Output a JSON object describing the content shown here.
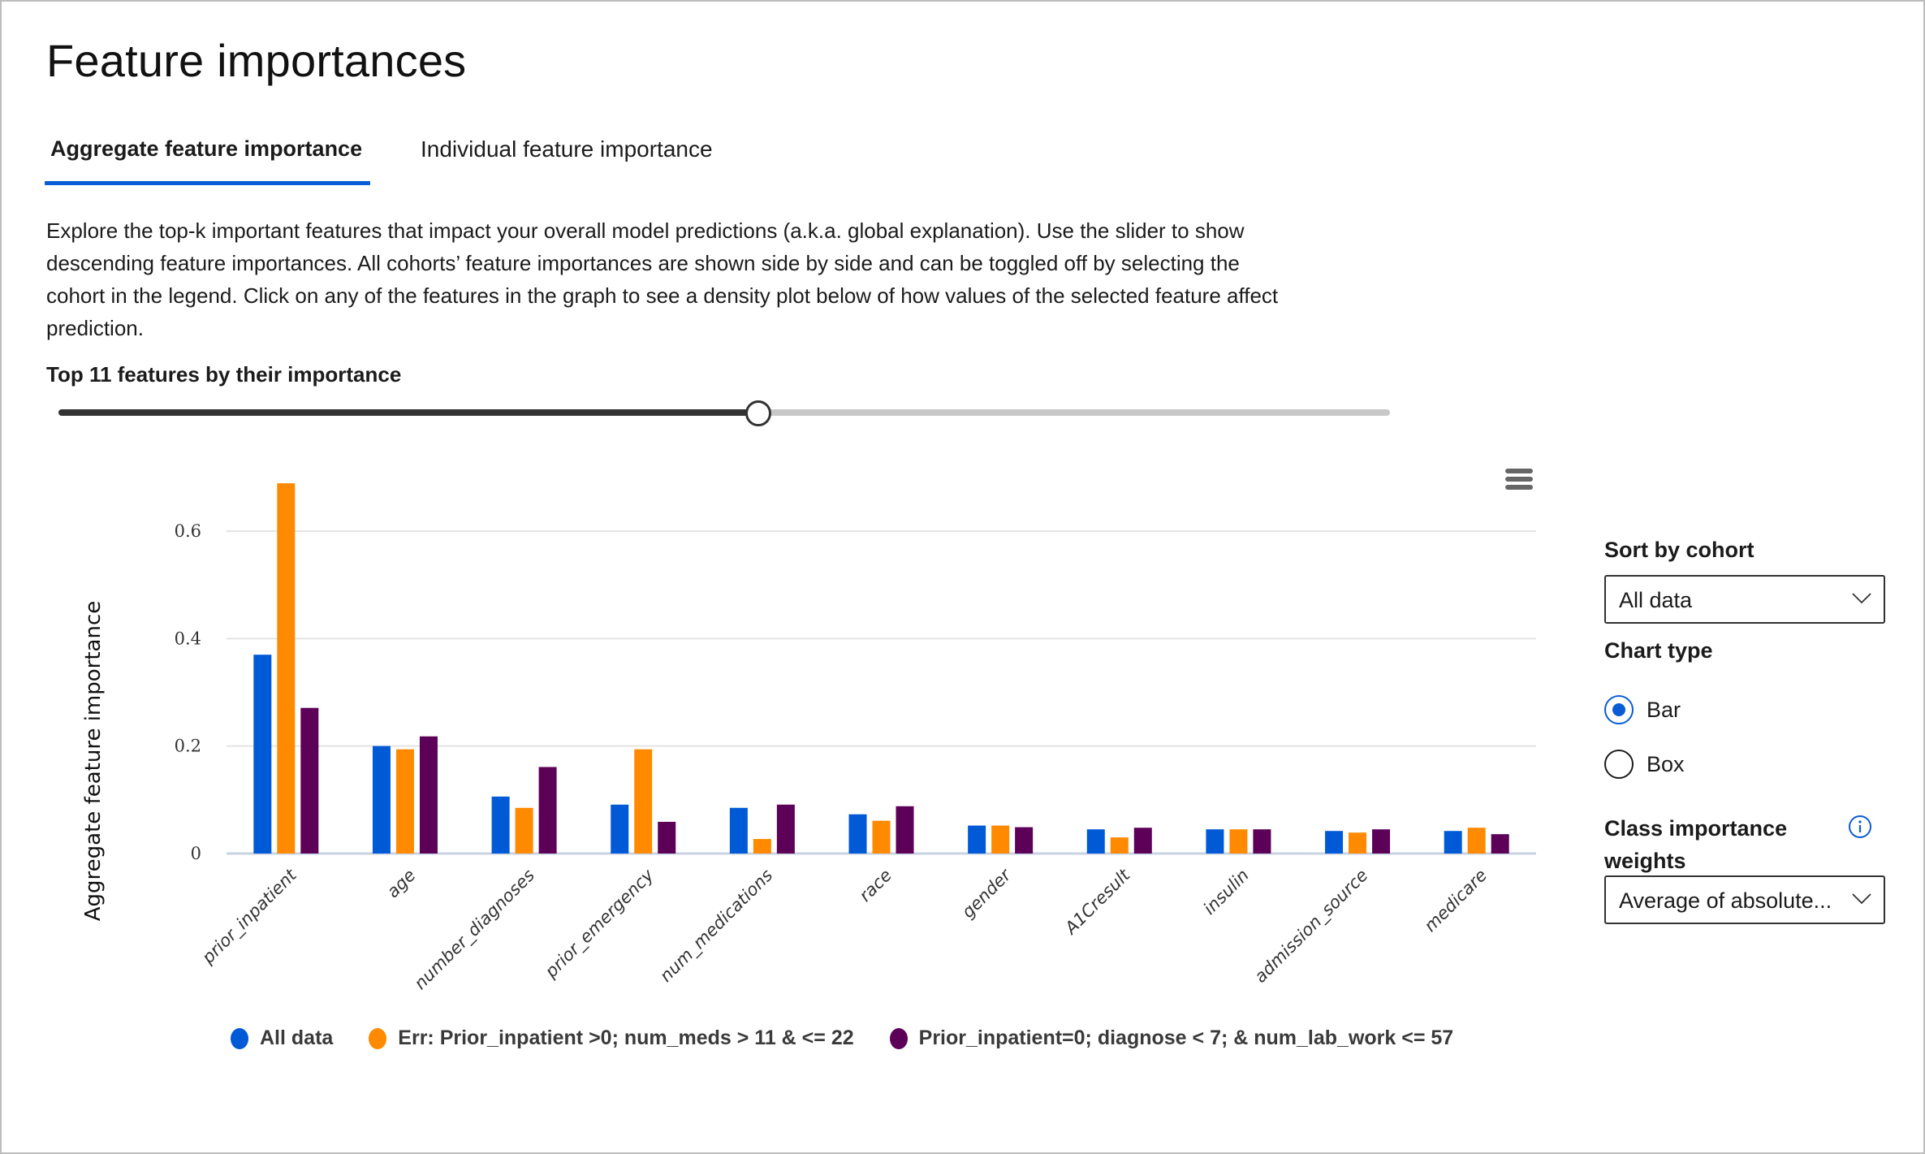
{
  "page": {
    "title": "Feature importances",
    "tabs": [
      {
        "label": "Aggregate feature importance",
        "selected": true
      },
      {
        "label": "Individual feature importance",
        "selected": false
      }
    ],
    "description": "Explore the top-k important features that impact your overall model predictions (a.k.a. global explanation). Use the slider to show descending feature importances. All cohorts’ feature importances are shown side by side and can be toggled off by selecting the cohort in the legend. Click on any of the features in the graph to see a density plot below of how values of the selected feature affect prediction."
  },
  "slider": {
    "label": "Top 11 features by their importance",
    "value": 11,
    "fraction": 0.525
  },
  "side_panel": {
    "sort_label": "Sort by cohort",
    "sort_value": "All data",
    "chart_type_label": "Chart type",
    "chart_types": [
      {
        "label": "Bar",
        "checked": true
      },
      {
        "label": "Box",
        "checked": false
      }
    ],
    "class_weights_label": "Class importance weights",
    "class_weights_value": "Average of absolute...",
    "info_icon": "info-icon"
  },
  "icons": {
    "menu": "hamburger-menu-icon",
    "dropdown": "chevron-down-icon",
    "info": "info-icon"
  },
  "colors": {
    "accent": "#0a5cd6",
    "all_data": "#005ad6",
    "err_cohort": "#ff8a00",
    "prior_cohort": "#5c0058"
  },
  "chart_data": {
    "type": "bar",
    "title": "",
    "xlabel": "",
    "ylabel": "Aggregate feature importance",
    "ylim": [
      0,
      0.72
    ],
    "yticks": [
      0,
      0.2,
      0.4,
      0.6
    ],
    "ytick_labels": [
      "0",
      "0.2",
      "0.4",
      "0.6"
    ],
    "grid": true,
    "legend_position": "bottom",
    "categories": [
      "prior_inpatient",
      "age",
      "number_diagnoses",
      "prior_emergency",
      "num_medications",
      "race",
      "gender",
      "A1Cresult",
      "insulin",
      "admission_source",
      "medicare"
    ],
    "series": [
      {
        "name": "All data",
        "color": "#005ad6",
        "values": [
          0.37,
          0.2,
          0.106,
          0.091,
          0.085,
          0.073,
          0.052,
          0.045,
          0.045,
          0.042,
          0.042
        ]
      },
      {
        "name": "Err: Prior_inpatient >0; num_meds > 11 & <= 22",
        "color": "#ff8a00",
        "values": [
          0.689,
          0.194,
          0.085,
          0.194,
          0.027,
          0.061,
          0.052,
          0.03,
          0.045,
          0.039,
          0.048
        ]
      },
      {
        "name": "Prior_inpatient=0; diagnose < 7; & num_lab_work <= 57",
        "color": "#5c0058",
        "values": [
          0.271,
          0.218,
          0.161,
          0.059,
          0.091,
          0.088,
          0.049,
          0.048,
          0.045,
          0.045,
          0.036
        ]
      }
    ]
  }
}
